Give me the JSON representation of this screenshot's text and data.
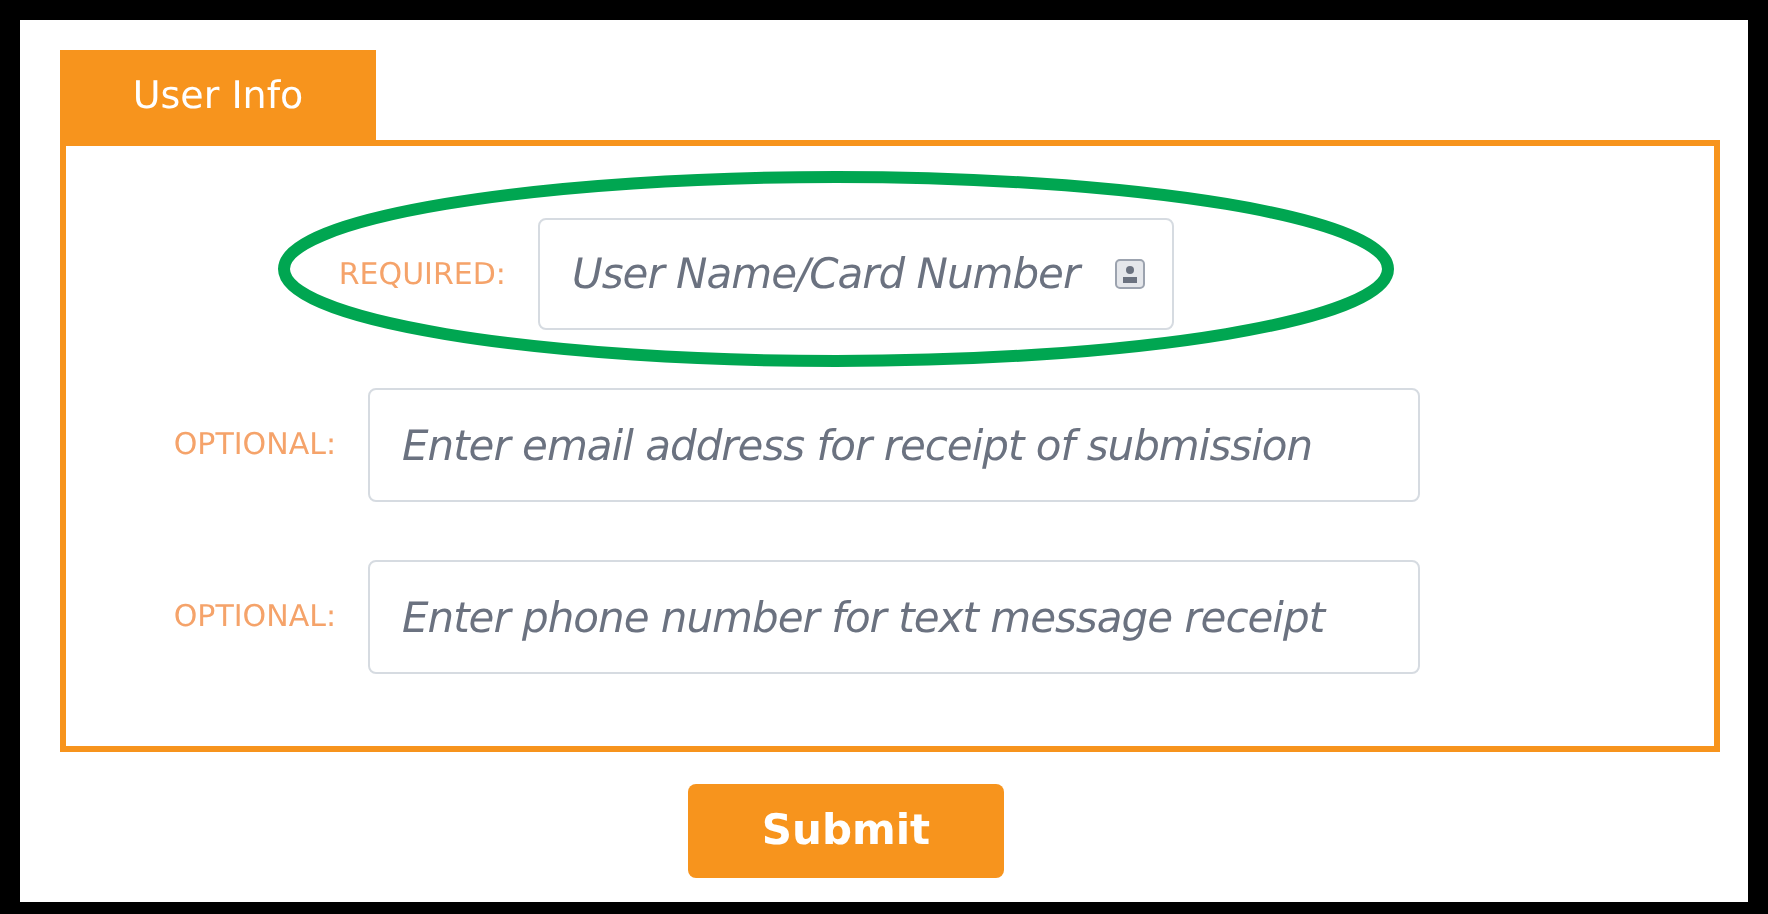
{
  "panel": {
    "tab": "User Info"
  },
  "fields": [
    {
      "label": "REQUIRED:",
      "placeholder": "User Name/Card Number",
      "kind": "card"
    },
    {
      "label": "OPTIONAL:",
      "placeholder": "Enter email address for receipt of submission",
      "kind": "plain"
    },
    {
      "label": "OPTIONAL:",
      "placeholder": "Enter phone number for text message receipt",
      "kind": "plain"
    }
  ],
  "buttons": [
    "Submit"
  ]
}
